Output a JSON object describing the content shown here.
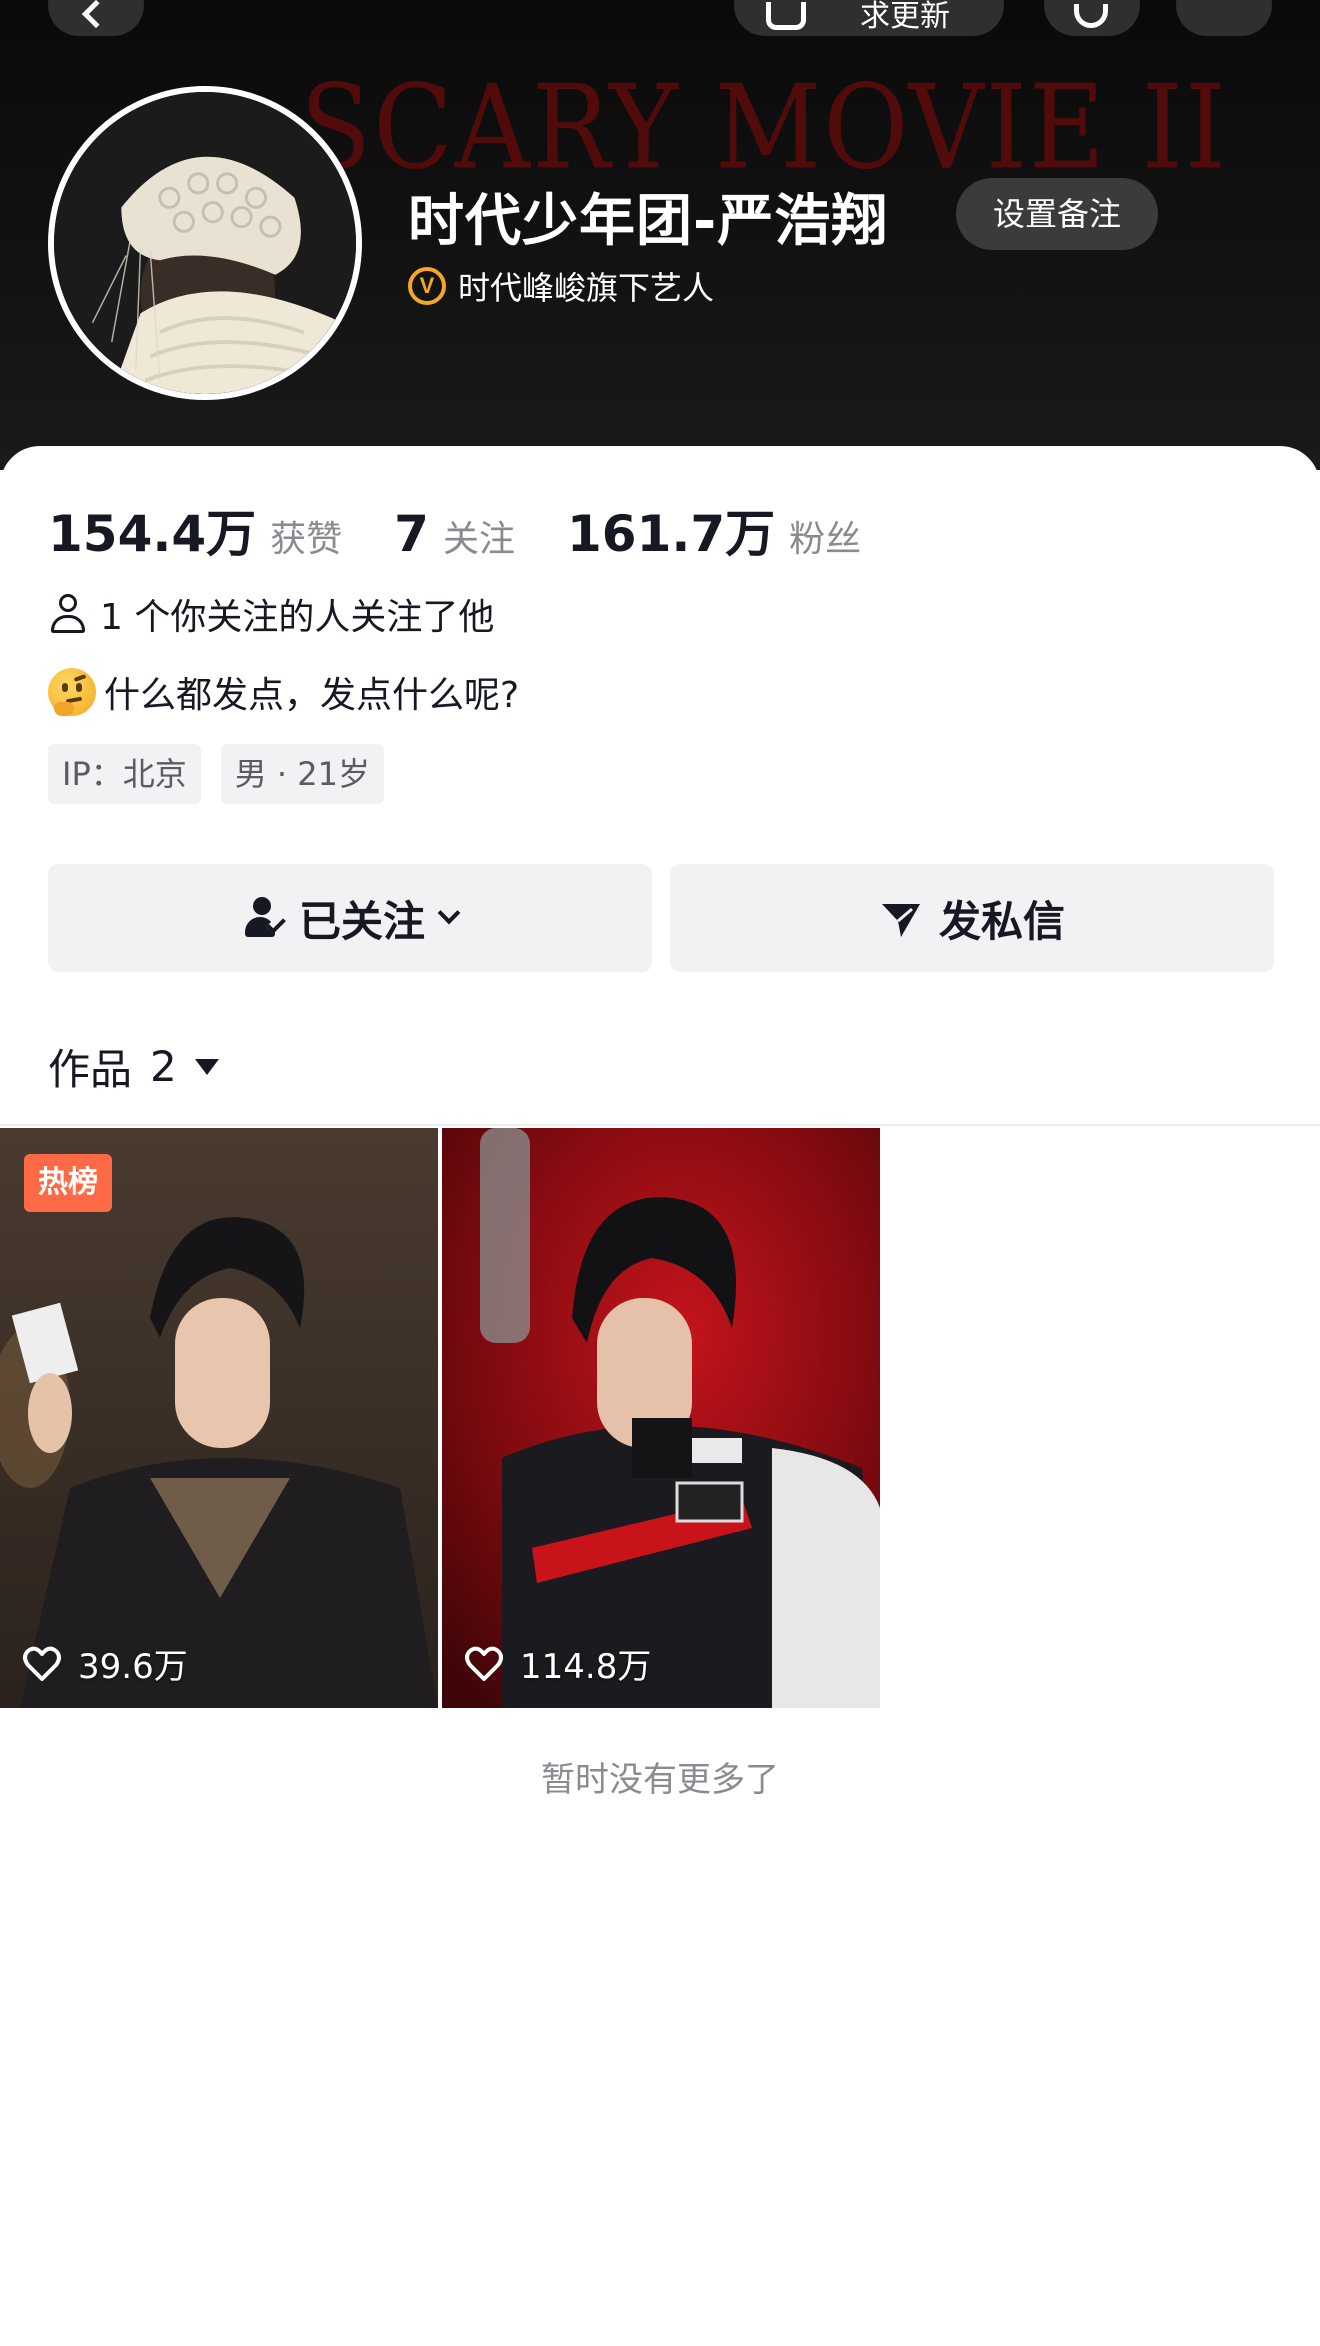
{
  "header": {
    "banner_text": "SCARY MOVIE II",
    "update_label": "求更新",
    "name": "时代少年团-严浩翔",
    "remark_button": "设置备注",
    "verify_badge": "V",
    "verify_text": "时代峰峻旗下艺人"
  },
  "stats": {
    "likes_value": "154.4万",
    "likes_label": "获赞",
    "following_value": "7",
    "following_label": "关注",
    "followers_value": "161.7万",
    "followers_label": "粉丝"
  },
  "mutual_text": "1 个你关注的人关注了他",
  "bio": "什么都发点，发点什么呢?",
  "tags": [
    "IP：北京",
    "男 · 21岁"
  ],
  "actions": {
    "followed_label": "已关注",
    "message_label": "发私信"
  },
  "works": {
    "label": "作品",
    "count": "2",
    "items": [
      {
        "badge": "热榜",
        "likes": "39.6万"
      },
      {
        "likes": "114.8万"
      }
    ],
    "end_text": "暂时没有更多了"
  },
  "colors": {
    "hot_badge": "#fe6a45",
    "verify": "#f5a623",
    "text_primary": "#161823",
    "text_secondary": "#8a8b91"
  },
  "icons": [
    "back-icon",
    "update-icon",
    "search-icon",
    "more-icon",
    "verified-icon",
    "person-icon",
    "thinking-emoji-icon",
    "followed-icon",
    "chevron-down-icon",
    "send-icon",
    "triangle-down-icon",
    "heart-icon"
  ]
}
